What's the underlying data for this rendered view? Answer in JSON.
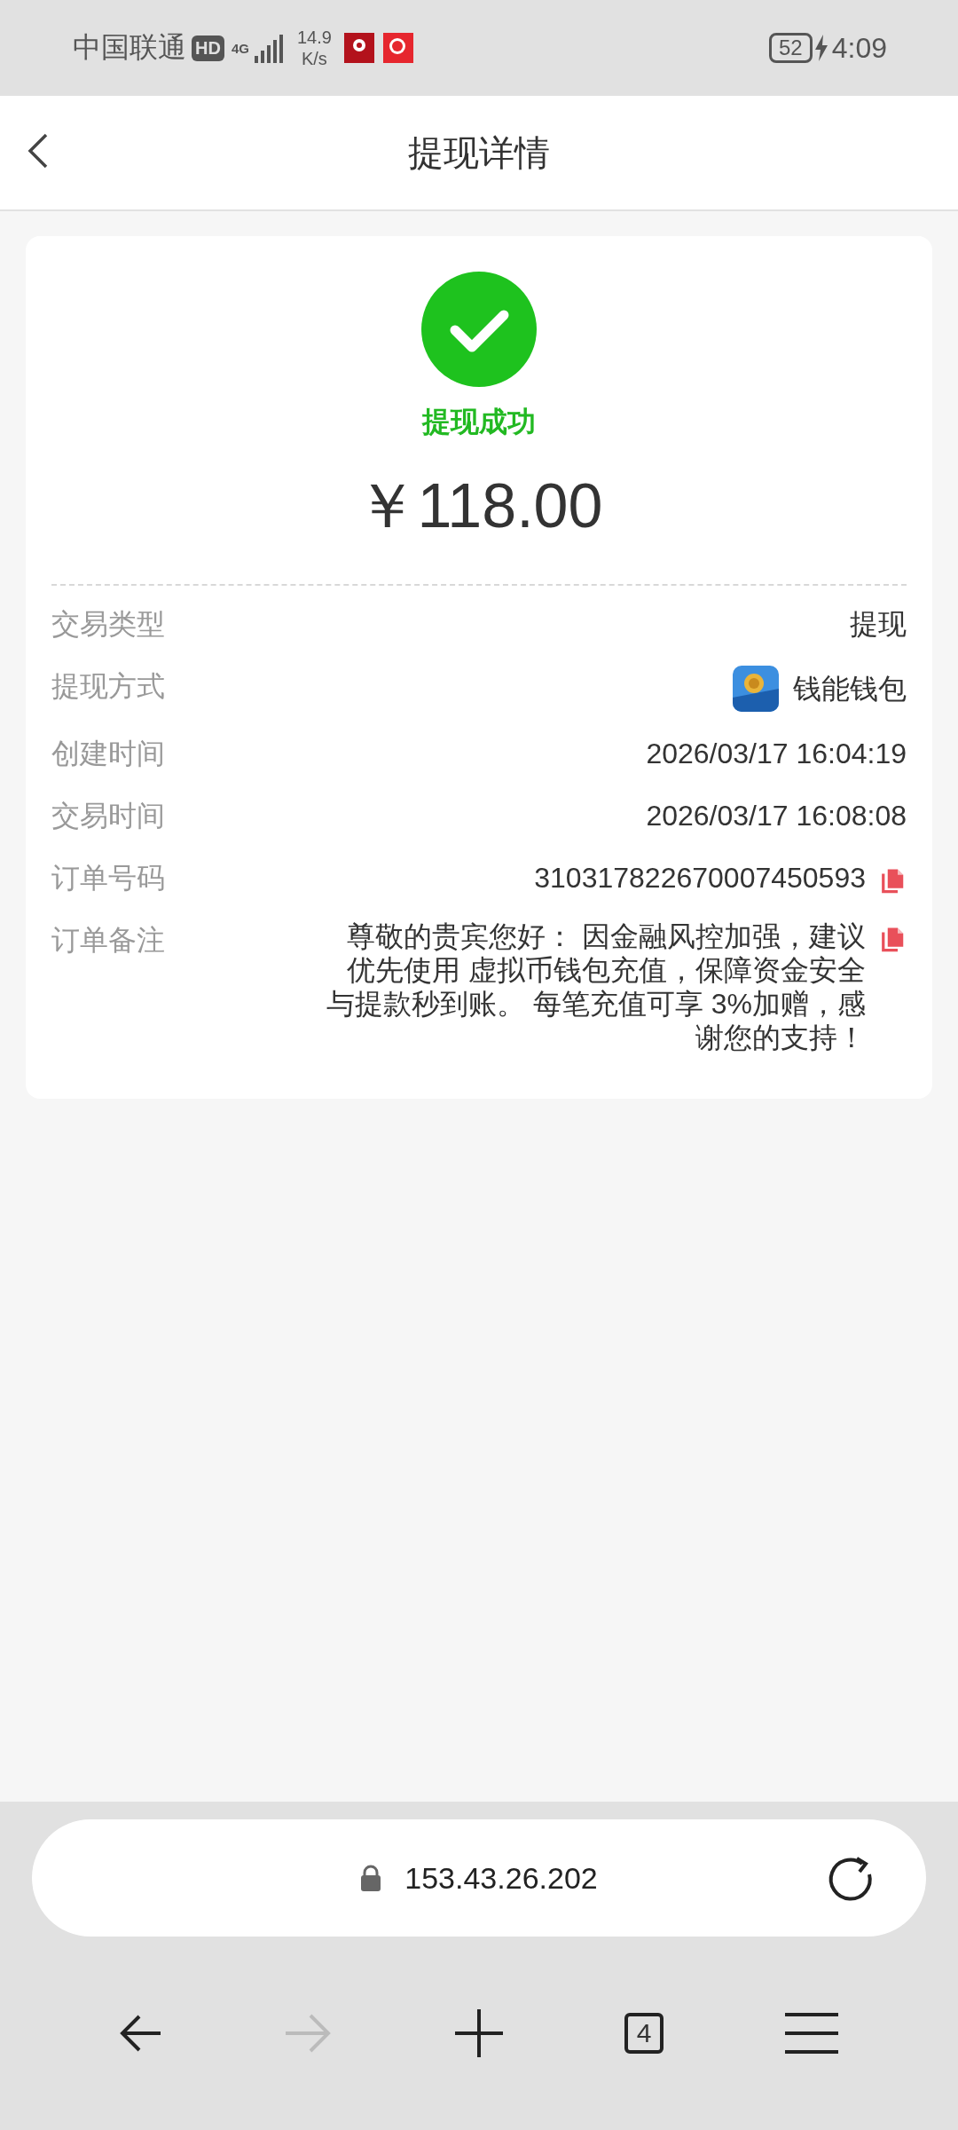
{
  "status_bar": {
    "carrier": "中国联通",
    "hd_badge": "HD",
    "network": "4G",
    "speed": [
      "14.9",
      "K/s"
    ],
    "battery": "52",
    "time": "4:09"
  },
  "header": {
    "title": "提现详情"
  },
  "result": {
    "status": "提现成功",
    "amount": "￥118.00"
  },
  "rows": [
    {
      "kind": "text",
      "label": "交易类型",
      "value": "提现"
    },
    {
      "kind": "app",
      "label": "提现方式",
      "value": "钱能钱包"
    },
    {
      "kind": "text",
      "label": "创建时间",
      "value": "2026/03/17 16:04:19"
    },
    {
      "kind": "text",
      "label": "交易时间",
      "value": "2026/03/17 16:08:08"
    },
    {
      "kind": "copy",
      "label": "订单号码",
      "value": "310317822670007450593"
    },
    {
      "kind": "note",
      "label": "订单备注",
      "value": "尊敬的贵宾您好： 因金融风控加强，建议优先使用 虚拟币钱包充值，保障资金安全与提款秒到账。 每笔充值可享 3%加赠，感谢您的支持！"
    }
  ],
  "browser": {
    "url": "153.43.26.202",
    "tab_count": "4",
    "forward_disabled": true
  }
}
